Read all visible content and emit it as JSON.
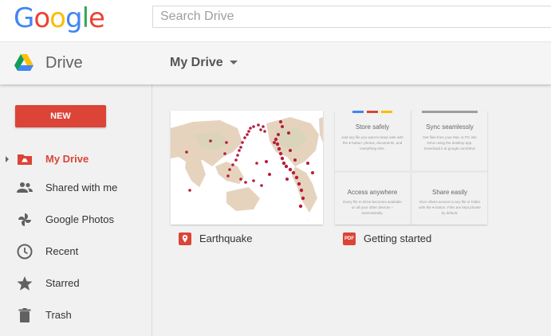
{
  "brand": {
    "logo_letters": [
      "G",
      "o",
      "o",
      "g",
      "l",
      "e"
    ],
    "logo_colors": [
      "#4285F4",
      "#EA4335",
      "#FBBC05",
      "#4285F4",
      "#34A853",
      "#EA4335"
    ]
  },
  "search": {
    "placeholder": "Search Drive",
    "value": ""
  },
  "app": {
    "name": "Drive"
  },
  "location": {
    "label": "My Drive"
  },
  "new_button": {
    "label": "NEW"
  },
  "accent_color": "#db4437",
  "sidebar": {
    "items": [
      {
        "label": "My Drive",
        "icon": "my-drive-icon",
        "active": true
      },
      {
        "label": "Shared with me",
        "icon": "shared-icon",
        "active": false
      },
      {
        "label": "Google Photos",
        "icon": "photos-icon",
        "active": false
      },
      {
        "label": "Recent",
        "icon": "clock-icon",
        "active": false
      },
      {
        "label": "Starred",
        "icon": "star-icon",
        "active": false
      },
      {
        "label": "Trash",
        "icon": "trash-icon",
        "active": false
      }
    ]
  },
  "files": [
    {
      "name": "Earthquake",
      "type_icon": "map-pin-icon",
      "type_color": "#db4437"
    },
    {
      "name": "Getting started",
      "type_icon": "pdf-icon",
      "type_badge": "PDF",
      "type_color": "#db4437"
    }
  ],
  "getting_started_preview": {
    "sections": [
      {
        "title": "Store safely",
        "text": "Add any file you want to keep safe with the ● button: photos, documents, and everything else."
      },
      {
        "title": "Sync seamlessly",
        "text": "Get files from your Mac or PC into Drive using the desktop app. Download it at google.com/drive"
      },
      {
        "title": "Access anywhere",
        "text": "Every file in Drive becomes available on all your other devices – automatically."
      },
      {
        "title": "Share easily",
        "text": "Give others access to any file or folder with the ● button. Files are kept private by default."
      }
    ]
  }
}
